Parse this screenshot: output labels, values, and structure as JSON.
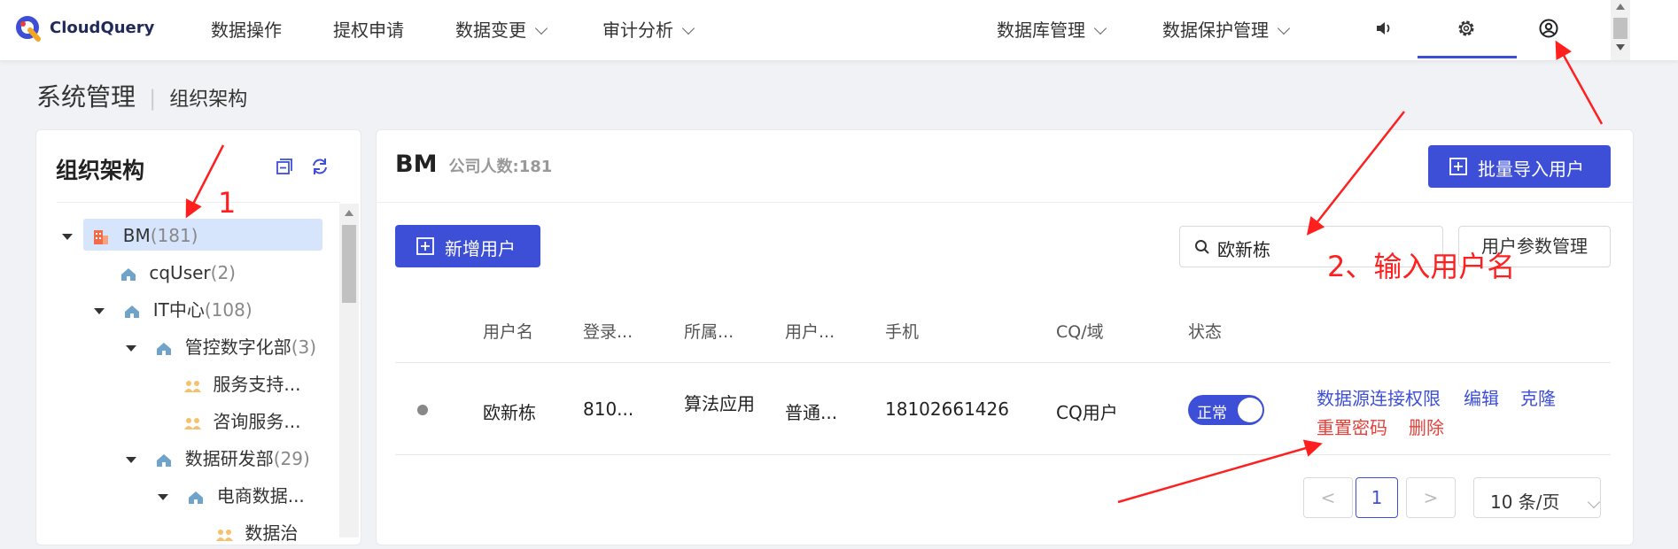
{
  "nav": {
    "logo": "CloudQuery",
    "items": [
      "数据操作",
      "提权申请",
      "数据变更",
      "审计分析"
    ],
    "right_items": [
      "数据库管理",
      "数据保护管理"
    ]
  },
  "breadcrumb": {
    "main": "系统管理",
    "sep": "|",
    "sub": "组织架构"
  },
  "tree": {
    "title": "组织架构",
    "nodes": [
      {
        "label": "BM",
        "count": "(181)"
      },
      {
        "label": "cqUser",
        "count": "(2)"
      },
      {
        "label": "IT中心",
        "count": "(108)"
      },
      {
        "label": "管控数字化部",
        "count": "(3)"
      },
      {
        "label": "服务支持...",
        "count": ""
      },
      {
        "label": "咨询服务...",
        "count": ""
      },
      {
        "label": "数据研发部",
        "count": "(29)"
      },
      {
        "label": "电商数据...",
        "count": ""
      },
      {
        "label": "数据治",
        "count": ""
      }
    ]
  },
  "main": {
    "title": "BM",
    "company_count": "公司人数:181",
    "import_button": "批量导入用户",
    "add_button": "新增用户",
    "search_value": "欧新栋",
    "params_button": "用户参数管理",
    "columns": [
      "用户名",
      "登录...",
      "所属...",
      "用户...",
      "手机",
      "CQ/域",
      "状态"
    ],
    "row": {
      "username": "欧新栋",
      "login": "810...",
      "dept": "算法应用",
      "role": "普通...",
      "phone": "18102661426",
      "domain": "CQ用户",
      "status": "正常"
    },
    "actions": {
      "perm": "数据源连接权限",
      "edit": "编辑",
      "clone": "克隆",
      "reset": "重置密码",
      "delete": "删除"
    },
    "pagination": {
      "prev": "<",
      "page": "1",
      "next": ">",
      "size": "10 条/页"
    }
  },
  "annotations": {
    "one": "1",
    "two": "2、输入用户名"
  },
  "colors": {
    "accent": "#3d4fd7",
    "annotation": "#ff1f1f"
  }
}
